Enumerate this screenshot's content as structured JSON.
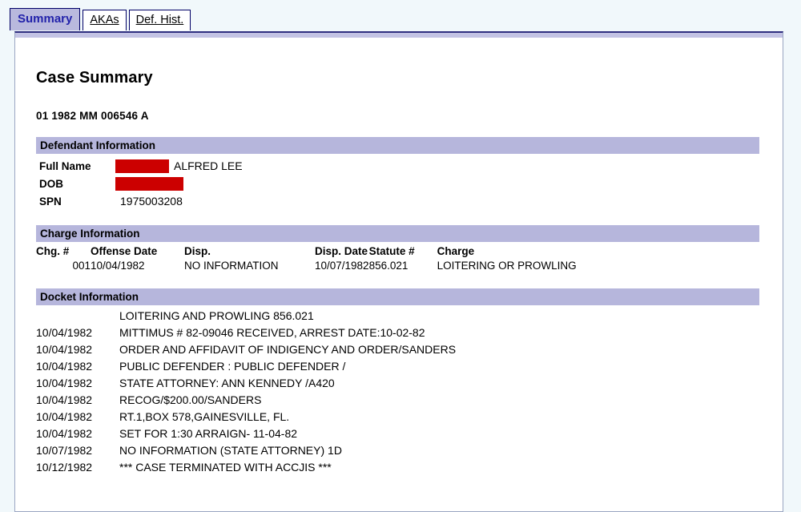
{
  "tabs": [
    {
      "label": "Summary",
      "active": true
    },
    {
      "label": "AKAs",
      "active": false
    },
    {
      "label": "Def. Hist.",
      "active": false
    }
  ],
  "page": {
    "title": "Case Summary",
    "case_number": "01 1982 MM 006546 A"
  },
  "defendant": {
    "section_title": "Defendant Information",
    "rows": [
      {
        "label": "Full Name",
        "redacted": true,
        "value": "ALFRED LEE"
      },
      {
        "label": "DOB",
        "redacted": true,
        "value": ""
      },
      {
        "label": "SPN",
        "redacted": false,
        "value": "1975003208"
      }
    ]
  },
  "charges": {
    "section_title": "Charge Information",
    "columns": [
      "Chg. #",
      "Offense Date",
      "Disp.",
      "Disp. Date",
      "Statute #",
      "Charge"
    ],
    "rows": [
      {
        "chg_no": "001",
        "offense_date": "10/04/1982",
        "disp": "NO INFORMATION",
        "disp_date": "10/07/1982",
        "statute": "856.021",
        "charge": "LOITERING OR PROWLING"
      }
    ]
  },
  "docket": {
    "section_title": "Docket Information",
    "rows": [
      {
        "date": "",
        "text": "LOITERING AND PROWLING 856.021"
      },
      {
        "date": "10/04/1982",
        "text": "MITTIMUS # 82-09046 RECEIVED, ARREST DATE:10-02-82"
      },
      {
        "date": "10/04/1982",
        "text": "ORDER AND AFFIDAVIT OF INDIGENCY AND ORDER/SANDERS"
      },
      {
        "date": "10/04/1982",
        "text": "PUBLIC DEFENDER : PUBLIC DEFENDER /"
      },
      {
        "date": "10/04/1982",
        "text": "STATE ATTORNEY: ANN KENNEDY /A420"
      },
      {
        "date": "10/04/1982",
        "text": "RECOG/$200.00/SANDERS"
      },
      {
        "date": "10/04/1982",
        "text": "RT.1,BOX 578,GAINESVILLE, FL."
      },
      {
        "date": "10/04/1982",
        "text": "SET FOR 1:30 ARRAIGN- 11-04-82"
      },
      {
        "date": "10/07/1982",
        "text": "NO INFORMATION (STATE ATTORNEY) 1D"
      },
      {
        "date": "10/12/1982",
        "text": "*** CASE TERMINATED WITH ACCJIS ***"
      }
    ]
  },
  "colors": {
    "section_bar": "#b6b6dc",
    "active_tab_bg": "#b9b9dd",
    "active_tab_text": "#2222aa",
    "redaction": "#cc0000",
    "page_background": "#f1f8fb",
    "panel_border": "#2f2f7f"
  }
}
